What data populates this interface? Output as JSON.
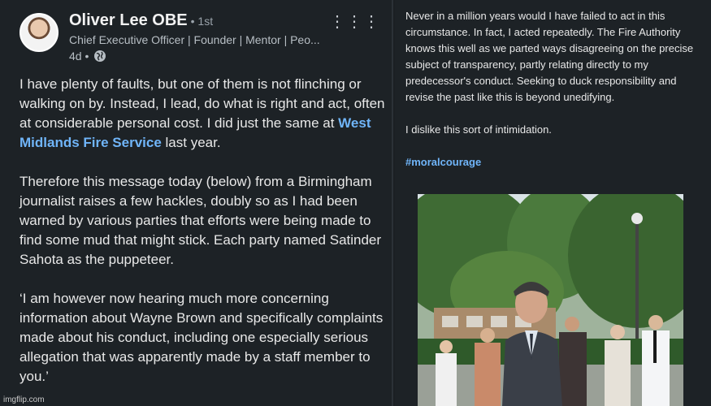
{
  "post": {
    "author_name": "Oliver Lee OBE",
    "degree": "• 1st",
    "headline": "Chief Executive Officer | Founder | Mentor | Peo...",
    "time": "4d •",
    "paragraph1_before_link": "I have plenty of faults, but one of them is not flinching or walking on by. Instead, I lead, do what is right and act, often at considerable personal cost. I did just the same at ",
    "link_text": "West Midlands Fire Service",
    "paragraph1_after_link": " last year.",
    "paragraph2": "Therefore this message today (below) from a Birmingham journalist raises a few hackles, doubly so as I had been warned by various parties that efforts were being made to find some mud that might stick. Each party named Satinder Sahota as the puppeteer.",
    "paragraph3": "‘I am however now hearing much more concerning information about Wayne Brown and specifically complaints made about his conduct, including one especially serious allegation that was apparently made by a staff member to you.’",
    "more_icon": "ellipsis-icon",
    "visibility_icon": "globe-icon"
  },
  "continuation": {
    "paragraph1": "Never in a million years would I have failed to act in this circumstance. In fact, I acted repeatedly. The Fire Authority knows this well as we parted ways disagreeing on the precise subject of transparency, partly relating directly to my predecessor's conduct. Seeking to duck responsibility and revise the past like this is beyond unedifying.",
    "paragraph2": "I dislike this sort of intimidation.",
    "hashtag": "#moralcourage"
  },
  "watermark": "imgflip.com",
  "colors": {
    "background": "#1d2226",
    "text": "#e8e8e8",
    "link": "#70b5f9",
    "muted": "#b7bec4"
  }
}
